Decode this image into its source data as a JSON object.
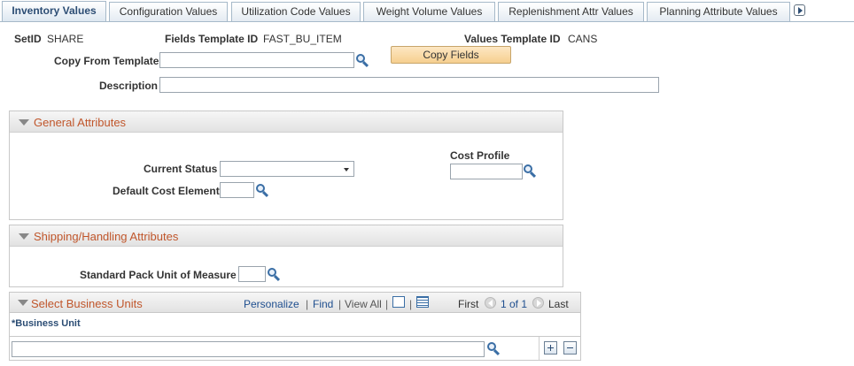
{
  "tabs": [
    {
      "label": "Inventory Values",
      "active": true
    },
    {
      "label": "Configuration Values",
      "active": false
    },
    {
      "label": "Utilization Code Values",
      "active": false
    },
    {
      "label": "Weight Volume Values",
      "active": false
    },
    {
      "label": "Replenishment Attr Values",
      "active": false
    },
    {
      "label": "Planning Attribute Values",
      "active": false
    }
  ],
  "header": {
    "setid_label": "SetID",
    "setid_value": "SHARE",
    "fields_template_label": "Fields Template ID",
    "fields_template_value": "FAST_BU_ITEM",
    "values_template_label": "Values Template ID",
    "values_template_value": "CANS",
    "copy_from_label": "Copy From Template",
    "copy_from_value": "",
    "copy_fields_button": "Copy Fields",
    "description_label": "Description",
    "description_value": ""
  },
  "general": {
    "title": "General Attributes",
    "current_status_label": "Current Status",
    "current_status_value": "",
    "cost_profile_label": "Cost Profile",
    "cost_profile_value": "",
    "default_cost_element_label": "Default Cost Element",
    "default_cost_element_value": ""
  },
  "shipping": {
    "title": "Shipping/Handling Attributes",
    "std_pack_uom_label": "Standard Pack Unit of Measure",
    "std_pack_uom_value": ""
  },
  "business_units": {
    "title": "Select Business Units",
    "personalize": "Personalize",
    "sep": "|",
    "find": "Find",
    "view_all": "View All",
    "first": "First",
    "page_info": "1 of 1",
    "last": "Last",
    "column_header": "*Business Unit",
    "rows": [
      {
        "business_unit": ""
      }
    ]
  },
  "colors": {
    "accent": "#c0562b",
    "link": "#1f4f8f",
    "tab_active_text": "#2c4d74"
  }
}
